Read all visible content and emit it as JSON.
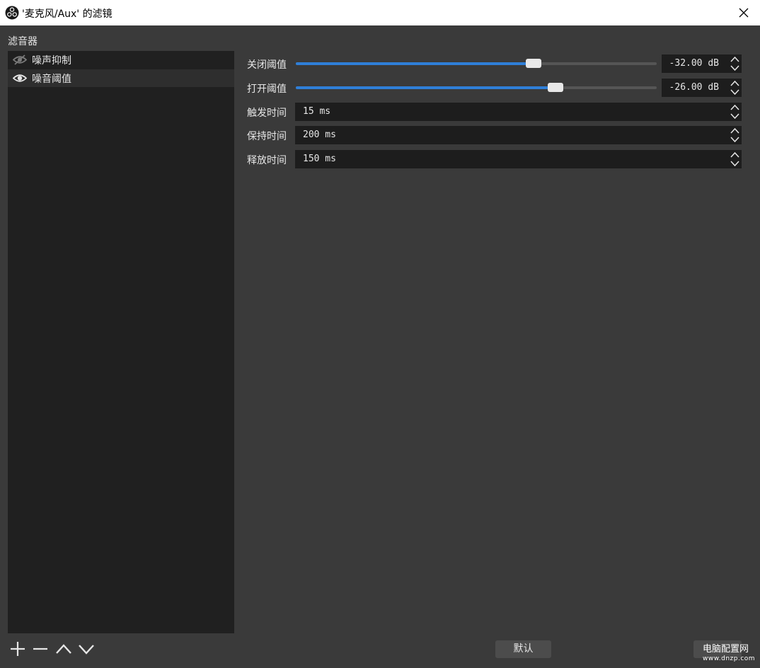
{
  "window": {
    "title": "'麦克风/Aux' 的滤镜"
  },
  "filters": {
    "label": "滤音器",
    "items": [
      {
        "label": "噪声抑制",
        "visible": false
      },
      {
        "label": "噪音阈值",
        "visible": true,
        "selected": true
      }
    ]
  },
  "properties": {
    "close_threshold": {
      "label": "关闭阈值",
      "value": "-32.00 dB",
      "slider_fraction": 0.658
    },
    "open_threshold": {
      "label": "打开阈值",
      "value": "-26.00 dB",
      "slider_fraction": 0.72
    },
    "attack_time": {
      "label": "触发时间",
      "value": "15 ms"
    },
    "hold_time": {
      "label": "保持时间",
      "value": "200 ms"
    },
    "release_time": {
      "label": "释放时间",
      "value": "150 ms"
    }
  },
  "toolbar": {
    "add": "add-icon",
    "remove": "remove-icon",
    "move_up": "chevron-up-icon",
    "move_down": "chevron-down-icon"
  },
  "buttons": {
    "defaults": "默认"
  },
  "watermark": {
    "line1": "电脑配置网",
    "line2": "www.dnzp.com"
  },
  "colors": {
    "accent": "#2f7fd8",
    "background": "#3a3a3a",
    "list_bg": "#202020"
  }
}
